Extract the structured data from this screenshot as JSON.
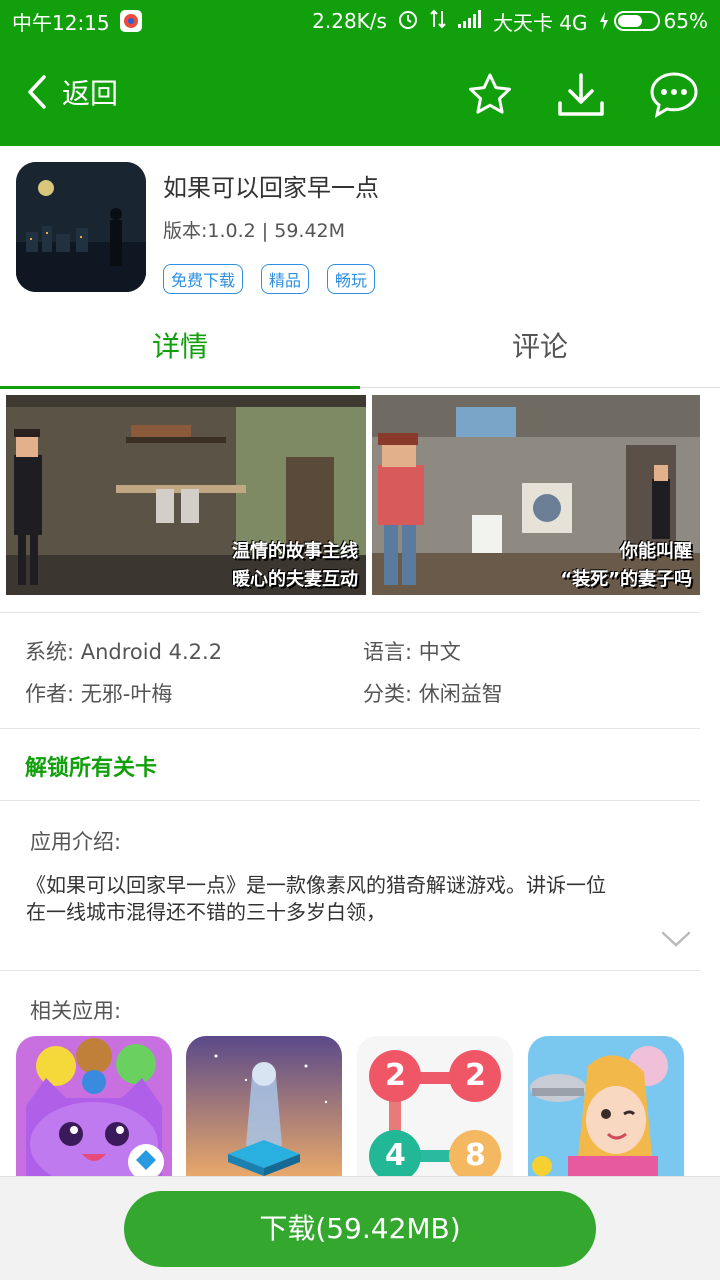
{
  "status_bar": {
    "time": "中午12:15",
    "net_speed": "2.28K/s",
    "carrier": "大天卡 4G",
    "battery": "65%",
    "battery_level": 0.65
  },
  "header": {
    "back_label": "返回",
    "icons": [
      "star-icon",
      "download-icon",
      "chat-icon"
    ]
  },
  "app": {
    "title": "如果可以回家早一点",
    "version": "版本:1.0.2 | 59.42M",
    "tags": [
      "免费下载",
      "精品",
      "畅玩"
    ]
  },
  "tabs": [
    "详情",
    "评论"
  ],
  "screenshots": [
    {
      "caption_line1": "温情的故事主线",
      "caption_line2": "暖心的夫妻互动"
    },
    {
      "caption_line1": "你能叫醒",
      "caption_line2": "“装死”的妻子吗"
    }
  ],
  "meta": {
    "system": "系统: Android 4.2.2",
    "language": "语言: 中文",
    "author": "作者: 无邪-叶梅",
    "category": "分类: 休闲益智"
  },
  "unlock_label": "解锁所有关卡",
  "intro": {
    "label": "应用介绍:",
    "text": "《如果可以回家早一点》是一款像素风的猎奇解谜游戏。讲诉一位在一线城市混得还不错的三十多岁白领，"
  },
  "related": {
    "label": "相关应用:",
    "tile_numbers": [
      "2",
      "2",
      "4",
      "8"
    ]
  },
  "download_button": "下载(59.42MB)",
  "colors": {
    "brand_green": "#11a00c",
    "button_green": "#34a72f",
    "tag_blue": "#2f8fe0"
  }
}
